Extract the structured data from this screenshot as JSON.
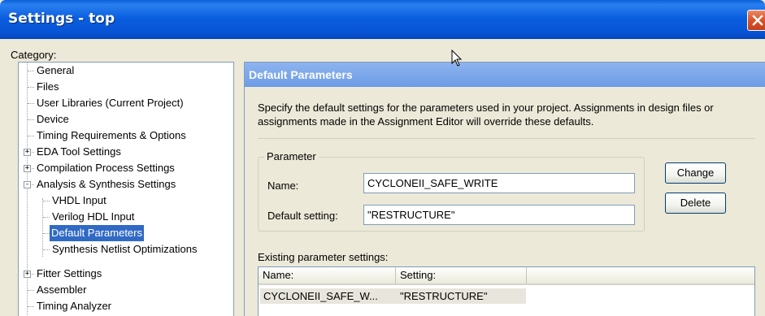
{
  "window": {
    "title": "Settings - top"
  },
  "category_label": "Category:",
  "tree": {
    "items": [
      {
        "label": "General",
        "expander": ""
      },
      {
        "label": "Files",
        "expander": ""
      },
      {
        "label": "User Libraries (Current Project)",
        "expander": ""
      },
      {
        "label": "Device",
        "expander": ""
      },
      {
        "label": "Timing Requirements & Options",
        "expander": ""
      },
      {
        "label": "EDA Tool Settings",
        "expander": "+"
      },
      {
        "label": "Compilation Process Settings",
        "expander": "+"
      },
      {
        "label": "Analysis & Synthesis Settings",
        "expander": "-"
      },
      {
        "label": "VHDL Input",
        "expander": ""
      },
      {
        "label": "Verilog HDL Input",
        "expander": ""
      },
      {
        "label": "Default Parameters",
        "expander": "",
        "selected": true
      },
      {
        "label": "Synthesis Netlist Optimizations",
        "expander": ""
      },
      {
        "label": "Fitter Settings",
        "expander": "+"
      },
      {
        "label": "Assembler",
        "expander": ""
      },
      {
        "label": "Timing Analyzer",
        "expander": ""
      }
    ]
  },
  "panel": {
    "title": "Default Parameters",
    "description": "Specify the default settings for the parameters used in your project.  Assignments in design files or assignments made in the Assignment Editor will override these defaults.",
    "group_label": "Parameter",
    "name_label": "Name:",
    "name_value": "CYCLONEII_SAFE_WRITE",
    "default_label": "Default setting:",
    "default_value": "\"RESTRUCTURE\"",
    "change_button": "Change",
    "delete_button": "Delete",
    "existing_label": "Existing parameter settings:",
    "list": {
      "columns": [
        "Name:",
        "Setting:"
      ],
      "rows": [
        {
          "name": "CYCLONEII_SAFE_W...",
          "setting": "\"RESTRUCTURE\""
        }
      ]
    }
  },
  "colors": {
    "titlebar": "#0b5fe0",
    "panel_header": "#7aa4ea",
    "selection": "#316ac5",
    "window_bg": "#ece9d8"
  },
  "icons": [
    "close-icon",
    "mouse-cursor-icon"
  ]
}
